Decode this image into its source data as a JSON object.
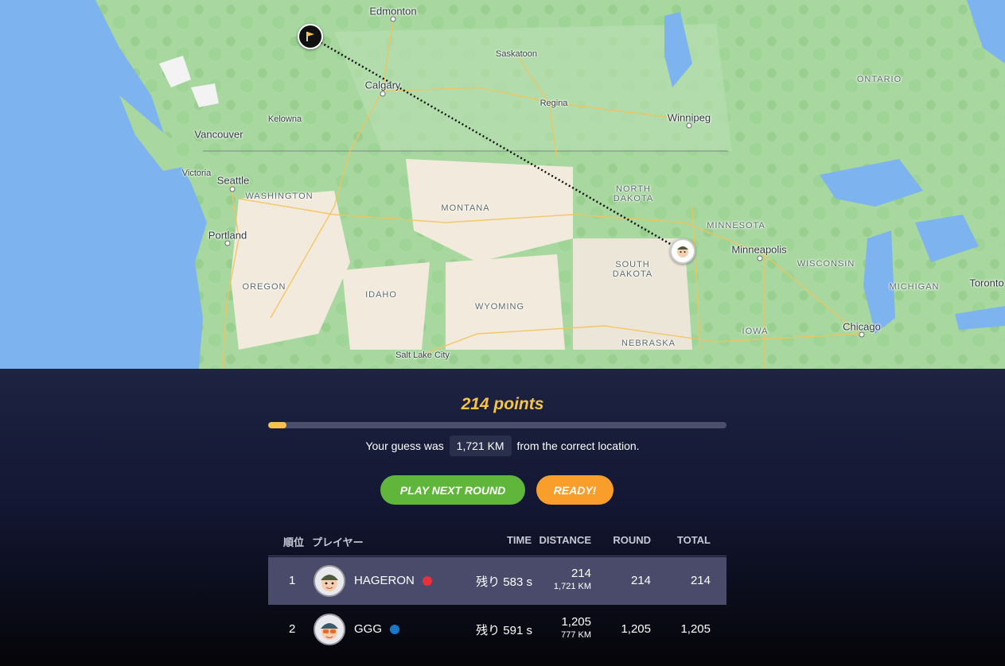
{
  "map": {
    "cities": [
      {
        "name": "Edmonton"
      },
      {
        "name": "Saskatoon"
      },
      {
        "name": "Calgary"
      },
      {
        "name": "Regina"
      },
      {
        "name": "Winnipeg"
      },
      {
        "name": "Kelowna"
      },
      {
        "name": "Vancouver"
      },
      {
        "name": "Victoria"
      },
      {
        "name": "Seattle"
      },
      {
        "name": "Portland"
      },
      {
        "name": "Salt Lake City"
      },
      {
        "name": "Minneapolis"
      },
      {
        "name": "Chicago"
      },
      {
        "name": "Toronto"
      }
    ],
    "regions": [
      {
        "name": "ONTARIO"
      },
      {
        "name": "WASHINGTON"
      },
      {
        "name": "MONTANA"
      },
      {
        "name": "NORTH DAKOTA"
      },
      {
        "name": "MINNESOTA"
      },
      {
        "name": "SOUTH DAKOTA"
      },
      {
        "name": "WISCONSIN"
      },
      {
        "name": "MICHIGAN"
      },
      {
        "name": "OREGON"
      },
      {
        "name": "IDAHO"
      },
      {
        "name": "WYOMING"
      },
      {
        "name": "IOWA"
      },
      {
        "name": "NEBRASKA"
      }
    ],
    "markers": {
      "correct": "flag-icon",
      "guess": "player-avatar-icon"
    }
  },
  "result": {
    "points_text": "214 points",
    "progress_fraction": 0.04,
    "guess_prefix": "Your guess was",
    "distance": "1,721 KM",
    "guess_suffix": "from the correct location."
  },
  "buttons": {
    "next": "PLAY NEXT ROUND",
    "ready": "READY!"
  },
  "colors": {
    "gold": "#f7c34a",
    "green": "#5fb63a",
    "orange": "#f99d2b"
  },
  "table": {
    "headers": {
      "rank": "順位",
      "player": "プレイヤー",
      "time": "TIME",
      "distance": "DISTANCE",
      "round": "ROUND",
      "total": "TOTAL"
    },
    "rows": [
      {
        "rank": "1",
        "name": "HAGERON",
        "dot_color": "#e8313d",
        "time": "残り 583 s",
        "score": "214",
        "distance": "1,721 KM",
        "round": "214",
        "total": "214"
      },
      {
        "rank": "2",
        "name": "GGG",
        "dot_color": "#1a78c8",
        "time": "残り 591 s",
        "score": "1,205",
        "distance": "777 KM",
        "round": "1,205",
        "total": "1,205"
      }
    ]
  }
}
